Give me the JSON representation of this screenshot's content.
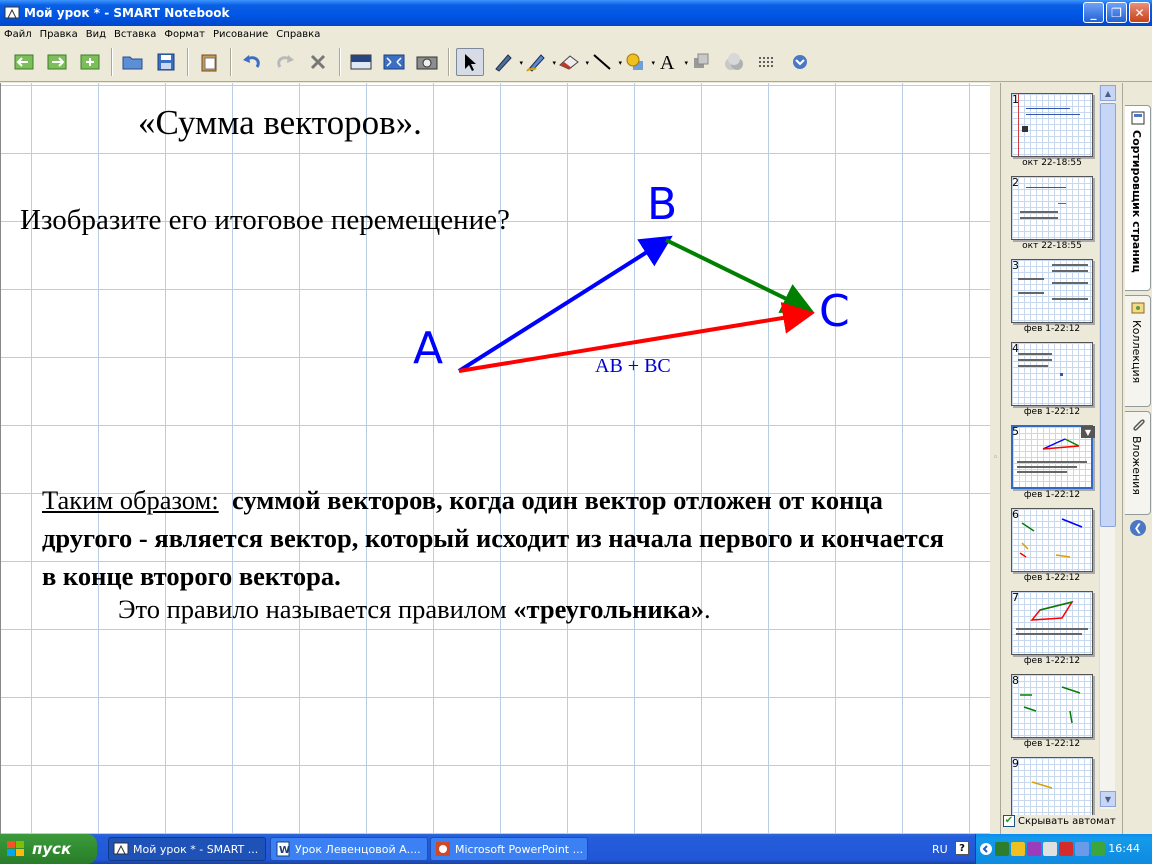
{
  "window": {
    "title": "Мой урок * - SMART Notebook",
    "buttons": [
      "minimize",
      "restore",
      "close"
    ]
  },
  "menu": [
    "Файл",
    "Правка",
    "Вид",
    "Вставка",
    "Формат",
    "Рисование",
    "Справка"
  ],
  "toolbar": {
    "items": [
      "prev-page",
      "next-page",
      "add-page",
      "open",
      "save",
      "paste",
      "undo",
      "redo",
      "delete",
      "screen-shade",
      "full-screen",
      "screen-capture",
      "select",
      "pen",
      "creative-pen",
      "eraser",
      "line",
      "shapes",
      "text",
      "fill",
      "properties",
      "move-toolbar",
      "more"
    ]
  },
  "slide": {
    "title": "«Сумма векторов».",
    "question": "Изобразите его итоговое перемещение?",
    "points": {
      "a": "A",
      "b": "B",
      "c": "C"
    },
    "formula": "AB + BC",
    "conclusion": {
      "lead": "Таким образом:",
      "bold_text": "суммой векторов, когда один вектор отложен от конца   другого - является вектор, который исходит из начала первого и кончается в конце второго вектора.",
      "rule_prefix": "Это правило называется правилом ",
      "rule_name": "«треугольника»",
      "rule_suffix": "."
    },
    "colors": {
      "ab": "#0000ff",
      "bc": "#008000",
      "ac": "#ff0000",
      "labels": "#0000ff"
    }
  },
  "sorter": {
    "pages": [
      {
        "num": "1",
        "date": "окт 22-18:55"
      },
      {
        "num": "2",
        "date": "окт 22-18:55"
      },
      {
        "num": "3",
        "date": "фев 1-22:12"
      },
      {
        "num": "4",
        "date": "фев 1-22:12"
      },
      {
        "num": "5",
        "date": "фев 1-22:12",
        "active": true
      },
      {
        "num": "6",
        "date": "фев 1-22:12"
      },
      {
        "num": "7",
        "date": "фев 1-22:12"
      },
      {
        "num": "8",
        "date": "фев 1-22:12"
      },
      {
        "num": "9",
        "date": ""
      }
    ],
    "autohide_label": "Скрывать автомат"
  },
  "side_tabs": {
    "page_sorter": "Сортировщик страниц",
    "gallery": "Коллекция",
    "attachments": "Вложения"
  },
  "taskbar": {
    "start": "пуск",
    "tasks": [
      {
        "label": "Мой урок * - SMART ..."
      },
      {
        "label": "Урок Левенцовой А...."
      },
      {
        "label": "Microsoft PowerPoint ..."
      }
    ],
    "lang": "RU",
    "help": "?",
    "clock": "16:44"
  }
}
